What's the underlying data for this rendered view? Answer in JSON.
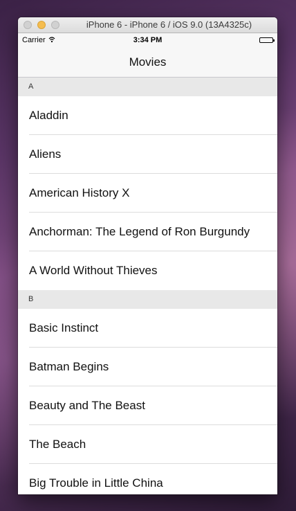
{
  "window": {
    "title": "iPhone 6 - iPhone 6 / iOS 9.0 (13A4325c)"
  },
  "status_bar": {
    "carrier": "Carrier",
    "time": "3:34 PM"
  },
  "nav": {
    "title": "Movies"
  },
  "sections": [
    {
      "header": "A",
      "rows": [
        "Aladdin",
        "Aliens",
        "American History X",
        "Anchorman: The Legend of Ron Burgundy",
        "A World Without Thieves"
      ]
    },
    {
      "header": "B",
      "rows": [
        "Basic Instinct",
        "Batman Begins",
        "Beauty and The Beast",
        "The Beach",
        "Big Trouble in Little China"
      ]
    }
  ]
}
